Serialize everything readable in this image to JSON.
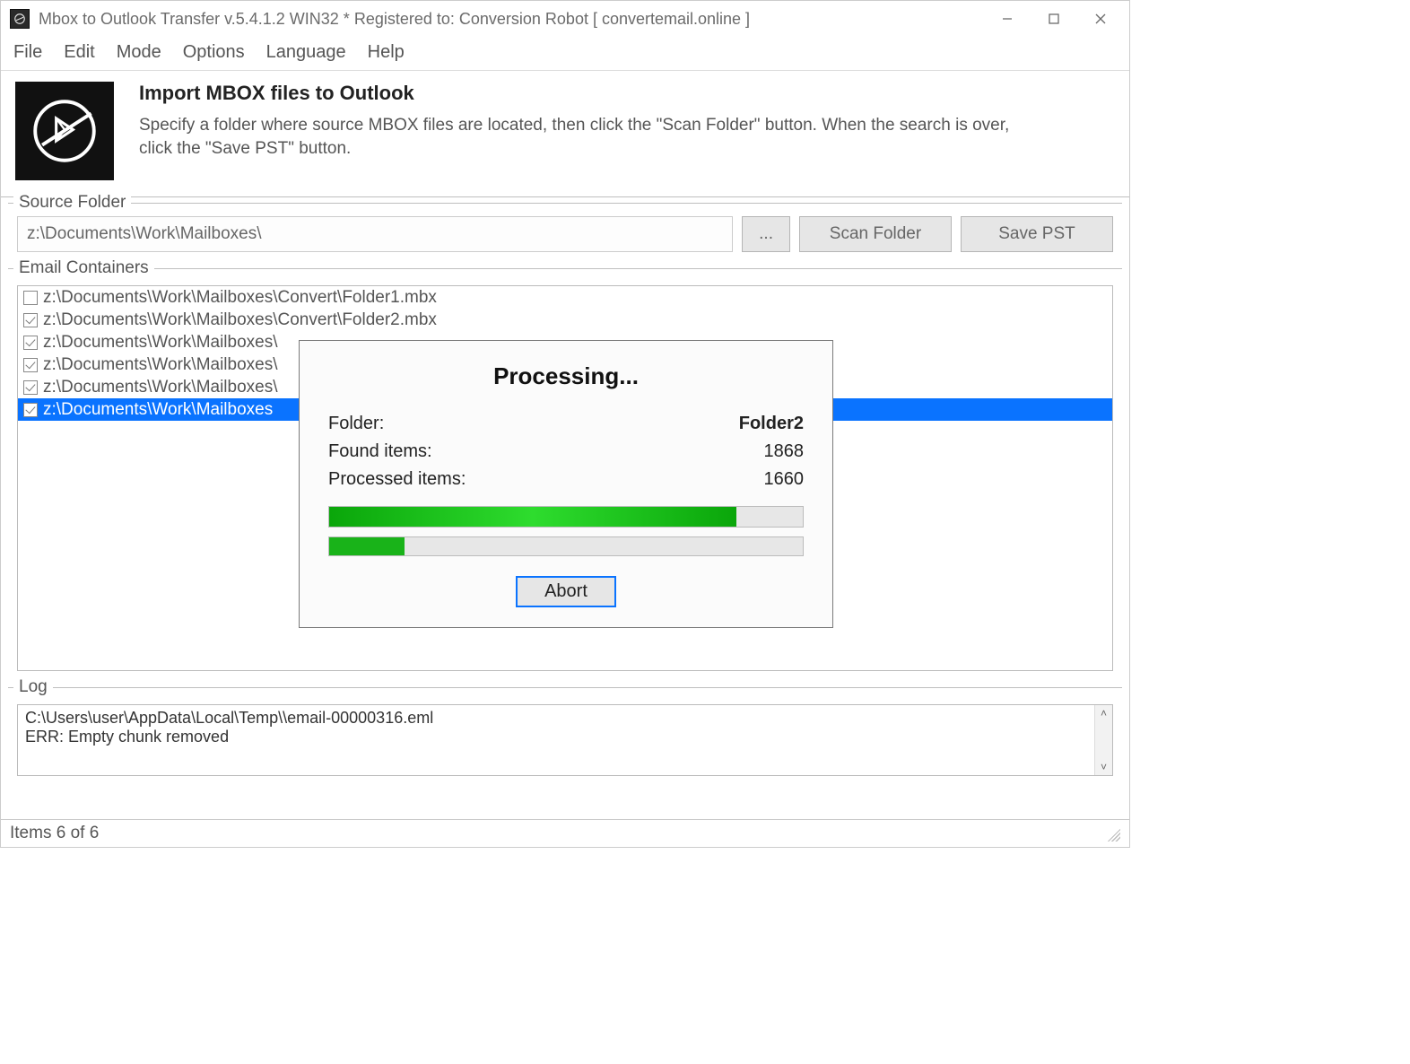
{
  "titlebar": {
    "title": "Mbox to Outlook Transfer v.5.4.1.2 WIN32 * Registered to: Conversion Robot [ convertemail.online ]"
  },
  "menu": [
    "File",
    "Edit",
    "Mode",
    "Options",
    "Language",
    "Help"
  ],
  "header": {
    "title": "Import MBOX files to Outlook",
    "desc": "Specify a folder where source MBOX files are located, then click the \"Scan Folder\" button. When the search is over, click the \"Save PST\" button."
  },
  "source": {
    "legend": "Source Folder",
    "path": "z:\\Documents\\Work\\Mailboxes\\",
    "browse": "...",
    "scan": "Scan Folder",
    "save": "Save PST"
  },
  "containers": {
    "legend": "Email Containers",
    "items": [
      {
        "checked": false,
        "selected": false,
        "label": "z:\\Documents\\Work\\Mailboxes\\Convert\\Folder1.mbx"
      },
      {
        "checked": true,
        "selected": false,
        "label": "z:\\Documents\\Work\\Mailboxes\\Convert\\Folder2.mbx"
      },
      {
        "checked": true,
        "selected": false,
        "label": "z:\\Documents\\Work\\Mailboxes\\"
      },
      {
        "checked": true,
        "selected": false,
        "label": "z:\\Documents\\Work\\Mailboxes\\"
      },
      {
        "checked": true,
        "selected": false,
        "label": "z:\\Documents\\Work\\Mailboxes\\"
      },
      {
        "checked": true,
        "selected": true,
        "label": "z:\\Documents\\Work\\Mailboxes"
      }
    ]
  },
  "log": {
    "legend": "Log",
    "lines": [
      "C:\\Users\\user\\AppData\\Local\\Temp\\\\email-00000316.eml",
      "ERR: Empty chunk removed"
    ]
  },
  "status": "Items 6 of 6",
  "dialog": {
    "title": "Processing...",
    "folder_label": "Folder:",
    "folder_value": "Folder2",
    "found_label": "Found items:",
    "found_value": "1868",
    "processed_label": "Processed items:",
    "processed_value": "1660",
    "progress1_pct": 86,
    "progress2_pct": 16,
    "abort": "Abort"
  }
}
